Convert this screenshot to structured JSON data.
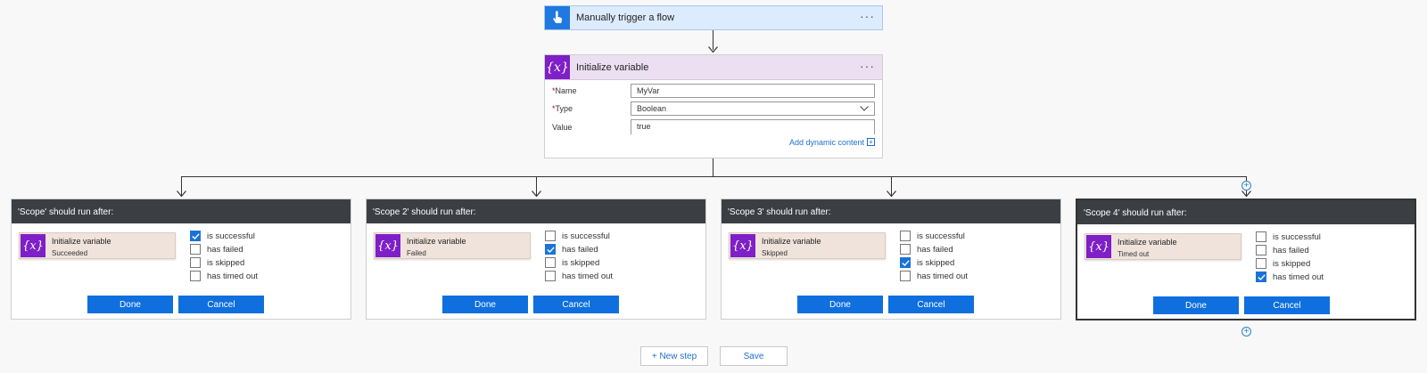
{
  "trigger": {
    "title": "Manually trigger a flow",
    "icon": "hand-tap-icon",
    "menu": "···"
  },
  "init_variable": {
    "title": "Initialize variable",
    "icon_text": "{x}",
    "menu": "···",
    "fields": {
      "name_label": "Name",
      "name_value": "MyVar",
      "type_label": "Type",
      "type_value": "Boolean",
      "value_label": "Value",
      "value_value": "true"
    },
    "required_mark": "*",
    "dynamic_content": "Add dynamic content",
    "dynamic_plus": "+"
  },
  "scopes": [
    {
      "header": "'Scope' should run after:",
      "card_title": "Initialize variable",
      "card_status": "Succeeded",
      "options": [
        "is successful",
        "has failed",
        "is skipped",
        "has timed out"
      ],
      "checked": "is successful"
    },
    {
      "header": "'Scope 2' should run after:",
      "card_title": "Initialize variable",
      "card_status": "Failed",
      "options": [
        "is successful",
        "has failed",
        "is skipped",
        "has timed out"
      ],
      "checked": "has failed"
    },
    {
      "header": "'Scope 3' should run after:",
      "card_title": "Initialize variable",
      "card_status": "Skipped",
      "options": [
        "is successful",
        "has failed",
        "is skipped",
        "has timed out"
      ],
      "checked": "is skipped"
    },
    {
      "header": "'Scope 4' should run after:",
      "card_title": "Initialize variable",
      "card_status": "Timed out",
      "options": [
        "is successful",
        "has failed",
        "is skipped",
        "has timed out"
      ],
      "checked": "has timed out"
    }
  ],
  "buttons": {
    "done": "Done",
    "cancel": "Cancel"
  },
  "plus": "+",
  "footer": {
    "new_step": "+ New step",
    "save": "Save"
  },
  "colors": {
    "accent": "#0f6fde",
    "variable": "#7e1fc7",
    "scope_header": "#3b3f44",
    "trigger": "#1f79e0"
  }
}
